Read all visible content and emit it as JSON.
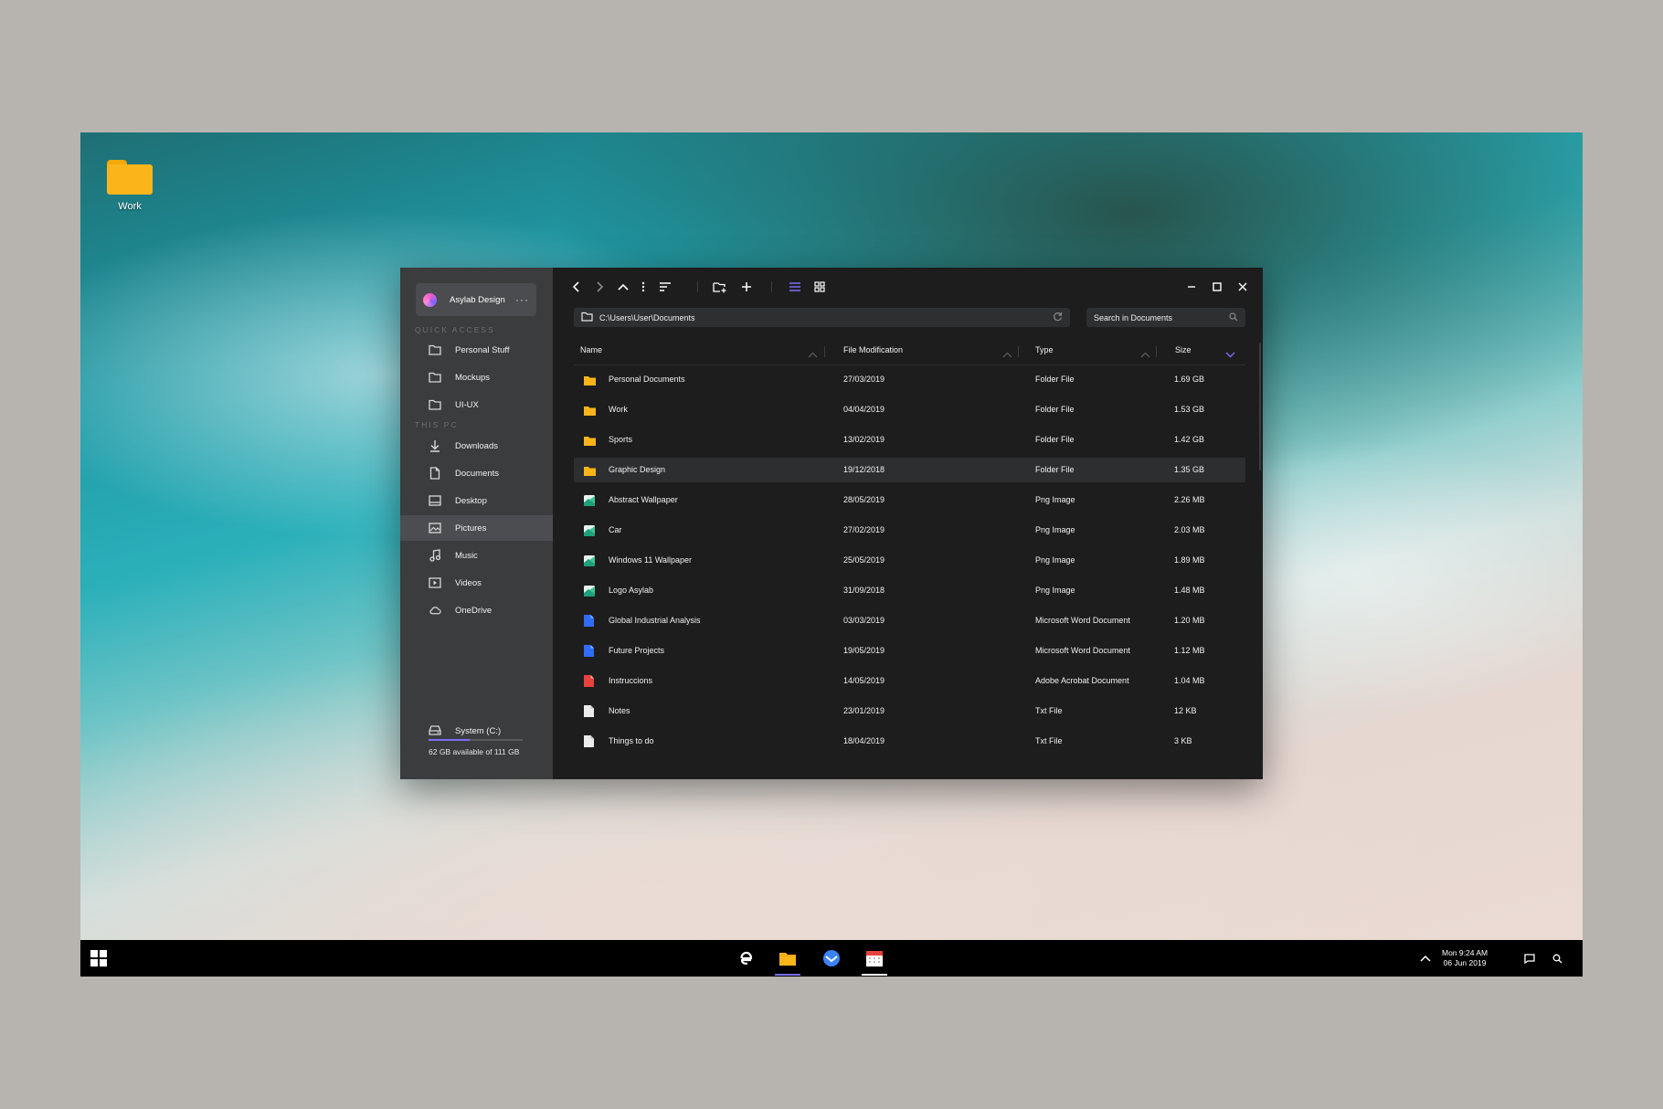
{
  "desktop": {
    "folder_label": "Work"
  },
  "account": {
    "name": "Asylab Design",
    "more": "···"
  },
  "sidebar": {
    "quick_access_title": "QUICK ACCESS",
    "this_pc_title": "THIS PC",
    "quick_access": [
      {
        "label": "Personal Stuff",
        "icon": "folder-icon"
      },
      {
        "label": "Mockups",
        "icon": "folder-icon"
      },
      {
        "label": "UI-UX",
        "icon": "folder-icon"
      }
    ],
    "this_pc": [
      {
        "label": "Downloads",
        "icon": "download-icon"
      },
      {
        "label": "Documents",
        "icon": "document-icon"
      },
      {
        "label": "Desktop",
        "icon": "desktop-icon"
      },
      {
        "label": "Pictures",
        "icon": "picture-icon",
        "active": true
      },
      {
        "label": "Music",
        "icon": "music-icon"
      },
      {
        "label": "Videos",
        "icon": "video-icon"
      },
      {
        "label": "OneDrive",
        "icon": "cloud-icon"
      }
    ],
    "storage": {
      "label": "System (C:)",
      "text": "62 GB available of 111 GB",
      "used_fraction": 0.44
    }
  },
  "toolbar": {
    "address": "C:\\Users\\User\\Documents",
    "search_placeholder": "Search in Documents"
  },
  "columns": {
    "name": "Name",
    "modified": "File Modification",
    "type": "Type",
    "size": "Size"
  },
  "files": [
    {
      "name": "Personal Documents",
      "modified": "27/03/2019",
      "type": "Folder File",
      "size": "1.69 GB",
      "kind": "folder"
    },
    {
      "name": "Work",
      "modified": "04/04/2019",
      "type": "Folder File",
      "size": "1.53 GB",
      "kind": "folder"
    },
    {
      "name": "Sports",
      "modified": "13/02/2019",
      "type": "Folder File",
      "size": "1.42 GB",
      "kind": "folder"
    },
    {
      "name": "Graphic Design",
      "modified": "19/12/2018",
      "type": "Folder File",
      "size": "1.35 GB",
      "kind": "folder",
      "selected": true
    },
    {
      "name": "Abstract Wallpaper",
      "modified": "28/05/2019",
      "type": "Png Image",
      "size": "2.26 MB",
      "kind": "image"
    },
    {
      "name": "Car",
      "modified": "27/02/2019",
      "type": "Png Image",
      "size": "2.03 MB",
      "kind": "image"
    },
    {
      "name": "Windows 11 Wallpaper",
      "modified": "25/05/2019",
      "type": "Png Image",
      "size": "1.89 MB",
      "kind": "image"
    },
    {
      "name": "Logo Asylab",
      "modified": "31/09/2018",
      "type": "Png Image",
      "size": "1.48 MB",
      "kind": "image"
    },
    {
      "name": "Global Industrial Analysis",
      "modified": "03/03/2019",
      "type": "Microsoft Word Document",
      "size": "1.20 MB",
      "kind": "word"
    },
    {
      "name": "Future Projects",
      "modified": "19/05/2019",
      "type": "Microsoft Word Document",
      "size": "1.12 MB",
      "kind": "word"
    },
    {
      "name": "Instruccions",
      "modified": "14/05/2019",
      "type": "Adobe Acrobat Document",
      "size": "1.04 MB",
      "kind": "pdf"
    },
    {
      "name": "Notes",
      "modified": "23/01/2019",
      "type": "Txt File",
      "size": "12 KB",
      "kind": "txt"
    },
    {
      "name": "Things to do",
      "modified": "18/04/2019",
      "type": "Txt File",
      "size": "3 KB",
      "kind": "txt"
    }
  ],
  "taskbar": {
    "clock_line1": "Mon 9:24 AM",
    "clock_line2": "06 Jun 2019"
  },
  "colors": {
    "accent": "#7b6ef6",
    "folder": "#fbb51a",
    "word": "#2f6df6",
    "pdf": "#e8423c"
  }
}
